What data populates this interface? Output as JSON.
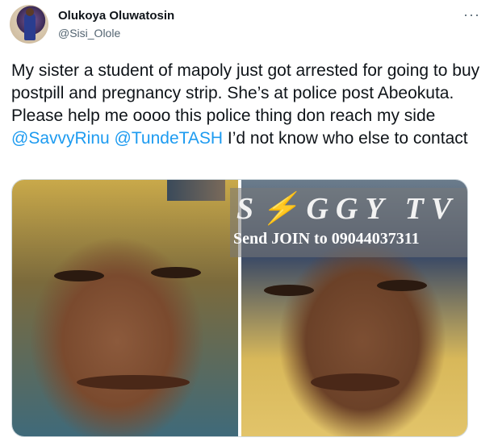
{
  "tweet": {
    "author": {
      "display_name": "Olukoya Oluwatosin",
      "handle": "@Sisi_Olole",
      "avatar_icon": "avatar-photo"
    },
    "more_label": "···",
    "text_before": "My sister a student of mapoly just got arrested for going to buy postpill and pregnancy strip. She’s at police post Abeokuta. Please help me oooo this police thing don reach my side ",
    "mention_1": "@SavvyRinu",
    "mention_2": "@TundeTASH",
    "text_after": " I’d not know who else to contact"
  },
  "media": {
    "watermark_title": "S⚡GGY TV",
    "watermark_subtitle": "Send JOIN to 09044037311"
  },
  "colors": {
    "mention": "#1d9bf0",
    "secondary_text": "#536471",
    "primary_text": "#0f1419"
  }
}
